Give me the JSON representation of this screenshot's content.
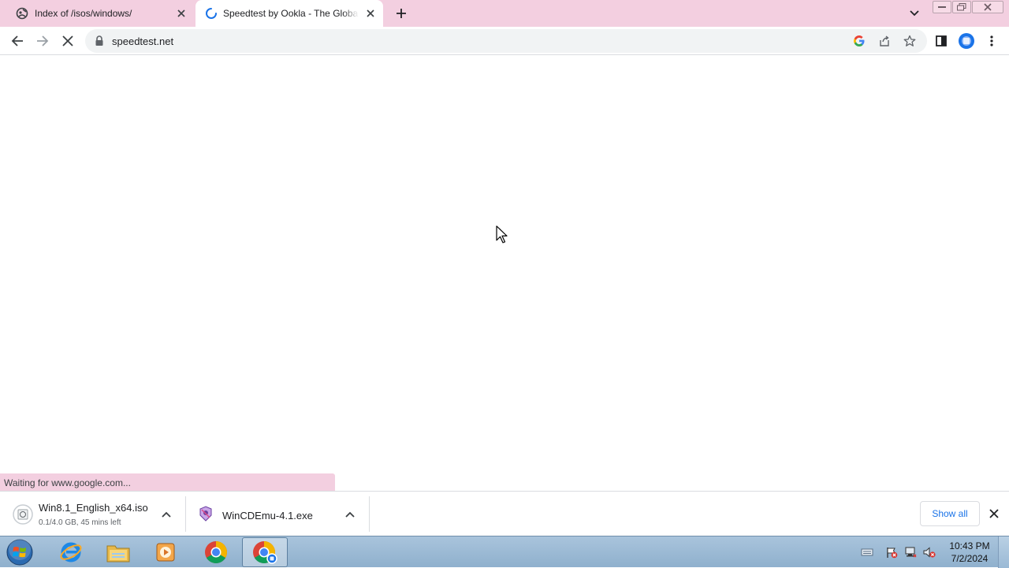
{
  "tabs": [
    {
      "title": "Index of /isos/windows/",
      "favicon": "site-icon",
      "active": false
    },
    {
      "title": "Speedtest by Ookla - The Global Broadband Speed Test",
      "favicon": "loading-spinner-icon",
      "active": true
    }
  ],
  "toolbar": {
    "url": "speedtest.net",
    "back": "back-arrow-icon",
    "forward": "forward-arrow-icon",
    "stop": "stop-icon"
  },
  "status_text": "Waiting for www.google.com...",
  "downloads": [
    {
      "filename": "Win8.1_English_x64.iso",
      "status": "0.1/4.0 GB, 45 mins left"
    },
    {
      "filename": "WinCDEmu-4.1.exe",
      "status": ""
    }
  ],
  "download_shelf": {
    "show_all_label": "Show all"
  },
  "taskbar": {
    "apps": [
      "internet-explorer",
      "windows-explorer",
      "media-player",
      "chrome",
      "chrome"
    ],
    "clock_time": "10:43 PM",
    "clock_date": "7/2/2024"
  },
  "colors": {
    "tabstrip": "#f3cfe0",
    "accent": "#1a73e8",
    "taskbar": "#9ab9d5"
  }
}
